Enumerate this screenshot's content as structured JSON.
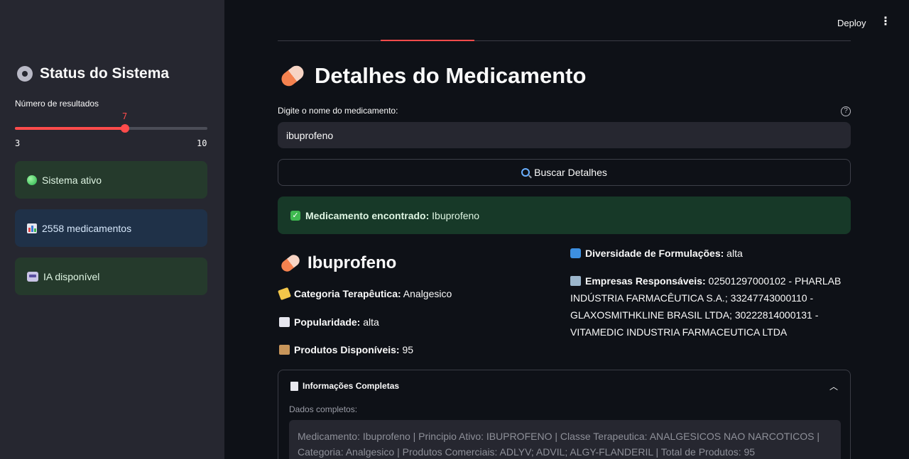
{
  "header": {
    "deploy_label": "Deploy",
    "menu_icon": "kebab-menu-icon"
  },
  "sidebar": {
    "title": "Status do Sistema",
    "slider": {
      "label": "Número de resultados",
      "value": "7",
      "min": "3",
      "max": "10"
    },
    "cards": [
      {
        "label": "Sistema ativo",
        "icon": "green-circle-icon"
      },
      {
        "label": "2558 medicamentos",
        "icon": "bar-chart-icon"
      },
      {
        "label": "IA disponível",
        "icon": "robot-icon"
      }
    ]
  },
  "main": {
    "title": "Detalhes do Medicamento",
    "input": {
      "label": "Digite o nome do medicamento:",
      "value": "ibuprofeno"
    },
    "search_button": "Buscar Detalhes",
    "success": {
      "bold": "Medicamento encontrado:",
      "value": " Ibuprofeno"
    },
    "medication": {
      "name": "Ibuprofeno",
      "categoria_label": "Categoria Terapêutica:",
      "categoria_value": " Analgesico",
      "popularidade_label": "Popularidade:",
      "popularidade_value": " alta",
      "produtos_label": "Produtos Disponíveis:",
      "produtos_value": " 95",
      "diversidade_label": "Diversidade de Formulações:",
      "diversidade_value": " alta",
      "empresas_label": "Empresas Responsáveis:",
      "empresas_value": " 02501297000102 - PHARLAB INDÚSTRIA FARMACÊUTICA S.A.; 33247743000110 - GLAXOSMITHKLINE BRASIL LTDA; 30222814000131 - VITAMEDIC INDUSTRIA FARMACEUTICA LTDA"
    },
    "expander": {
      "title": "Informações Completas",
      "label": "Dados completos:",
      "text": "Medicamento: Ibuprofeno | Principio Ativo: IBUPROFENO | Classe Terapeutica: ANALGESICOS NAO NARCOTICOS | Categoria: Analgesico | Produtos Comerciais: ADLYV; ADVIL; ALGY-FLANDERIL | Total de Produtos: 95"
    }
  },
  "colors": {
    "accent": "#ff4b4b",
    "background": "#0e1117",
    "sidebar": "#262730",
    "success_bg": "#173928"
  }
}
